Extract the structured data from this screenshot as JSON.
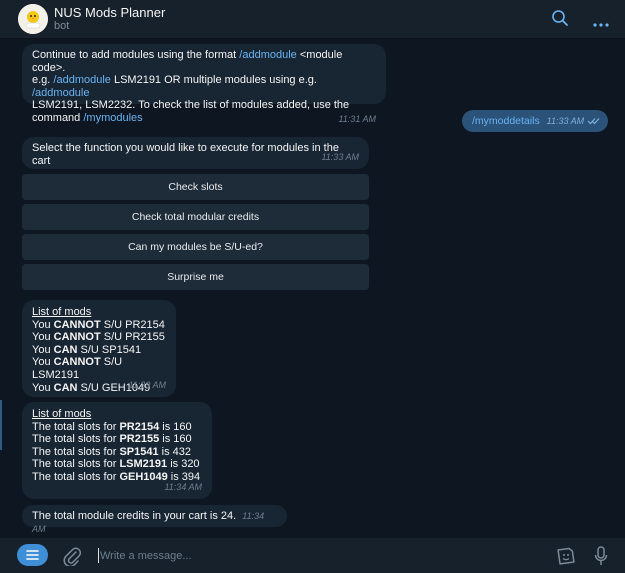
{
  "header": {
    "title": "NUS Mods Planner",
    "subtitle": "bot",
    "avatar_text": "Mods Planner"
  },
  "messages": {
    "m1": {
      "line1_text": "Continue to add modules using the format ",
      "line1_link": "/addmodule",
      "line1_tail": " <module code>.",
      "line2_head": "e.g. ",
      "line2_link1": "/addmodule",
      "line2_mid": " LSM2191 OR multiple modules using e.g. ",
      "line2_link2": "/addmodule",
      "line3": "LSM2191, LSM2232. To check the list of modules added, use the",
      "line4_head": "command ",
      "line4_link": "/mymodules",
      "time": "11:31 AM"
    },
    "out": {
      "text": "/mymoddetails",
      "time": "11:33 AM"
    },
    "m2": {
      "text": "Select the function you would like to execute for modules in the cart",
      "time": "11:33 AM"
    },
    "buttons": [
      "Check slots",
      "Check total modular credits",
      "Can my modules be S/U-ed?",
      "Surprise me"
    ],
    "m3": {
      "heading": "List of mods",
      "rows": [
        {
          "a": "You ",
          "b": "CANNOT",
          "c": " S/U PR2154"
        },
        {
          "a": "You ",
          "b": "CANNOT",
          "c": " S/U PR2155"
        },
        {
          "a": "You ",
          "b": "CAN",
          "c": " S/U SP1541"
        },
        {
          "a": "You ",
          "b": "CANNOT",
          "c": " S/U LSM2191"
        },
        {
          "a": "You ",
          "b": "CAN",
          "c": " S/U GEH1049"
        }
      ],
      "time": "11:33 AM"
    },
    "m4": {
      "heading": "List of mods",
      "rows": [
        {
          "a": "The total slots for ",
          "b": "PR2154",
          "c": " is 160"
        },
        {
          "a": "The total slots for ",
          "b": "PR2155",
          "c": " is 160"
        },
        {
          "a": "The total slots for ",
          "b": "SP1541",
          "c": " is 432"
        },
        {
          "a": "The total slots for ",
          "b": "LSM2191",
          "c": " is 320"
        },
        {
          "a": "The total slots for ",
          "b": "GEH1049",
          "c": " is 394"
        }
      ],
      "time": "11:34 AM"
    },
    "m5": {
      "text": "The total module credits in your cart is 24.",
      "time": "11:34 AM"
    }
  },
  "composer": {
    "placeholder": "Write a message..."
  },
  "icons": {
    "search": "search-icon",
    "more": "more-icon",
    "menu": "menu-icon",
    "attach": "paperclip-icon",
    "sticker": "sticker-icon",
    "mic": "microphone-icon"
  },
  "colors": {
    "background": "#0e1621",
    "header": "#17212b",
    "incoming": "#182533",
    "outgoing": "#2b5278",
    "link": "#6ab3f3",
    "accent": "#3e8fd6"
  }
}
